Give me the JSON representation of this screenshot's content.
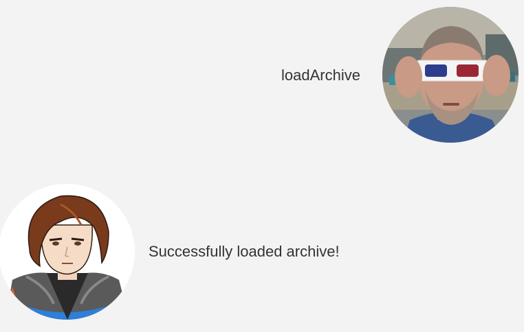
{
  "conversation": {
    "user_message": {
      "text": "loadArchive",
      "avatar_icon": "user-photo-3d-glasses-avatar"
    },
    "bot_message": {
      "text": "Successfully loaded archive!",
      "avatar_icon": "anime-character-avatar"
    }
  },
  "colors": {
    "background": "#f3f3f3",
    "text": "#333333",
    "bot_jacket_accent": "#2f7ed8",
    "bot_jacket_orange": "#e8652a"
  }
}
